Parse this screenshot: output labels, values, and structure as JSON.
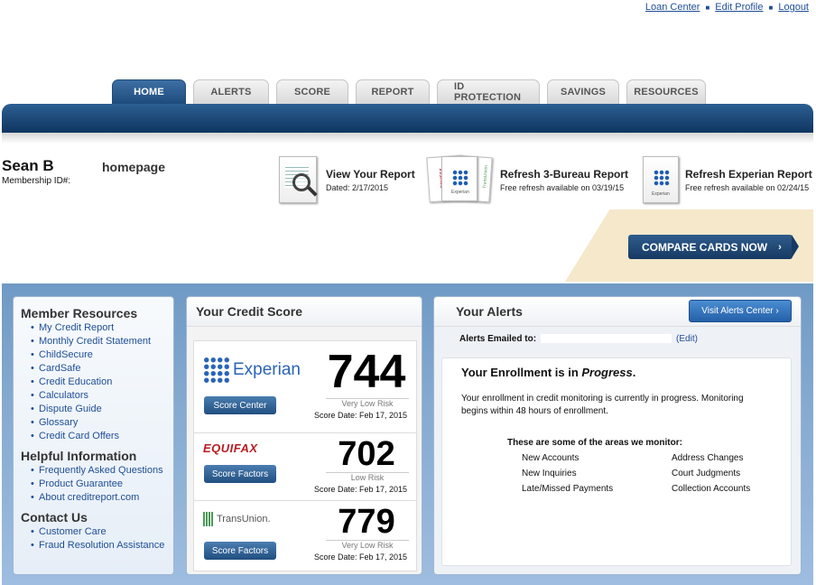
{
  "top_links": [
    "Loan Center",
    "Edit Profile",
    "Logout"
  ],
  "tabs": [
    "HOME",
    "ALERTS",
    "SCORE",
    "REPORT",
    "ID PROTECTION",
    "SAVINGS",
    "RESOURCES"
  ],
  "active_tab": "HOME",
  "user": {
    "name": "Sean B",
    "membership_label": "Membership ID#:",
    "page_label": "homepage"
  },
  "actions": [
    {
      "title": "View Your Report",
      "sub": "Dated: 2/17/2015"
    },
    {
      "title": "Refresh 3-Bureau Report",
      "sub": "Free refresh available on 03/19/15"
    },
    {
      "title": "Refresh Experian Report",
      "sub": "Free refresh available on 02/24/15"
    }
  ],
  "doc_logo_labels": [
    "EQUIFAX",
    "Experian",
    "TransUnion",
    "Experian"
  ],
  "compare_button": "COMPARE CARDS NOW",
  "resources": {
    "member_title": "Member Resources",
    "member_items": [
      "My Credit Report",
      "Monthly Credit Statement",
      "ChildSecure",
      "CardSafe",
      "Credit Education",
      "Calculators",
      "Dispute Guide",
      "Glossary",
      "Credit Card Offers"
    ],
    "helpful_title": "Helpful Information",
    "helpful_items": [
      "Frequently Asked Questions",
      "Product Guarantee",
      "About creditreport.com"
    ],
    "contact_title": "Contact Us",
    "contact_items": [
      "Customer Care",
      "Fraud Resolution Assistance"
    ]
  },
  "credit_score": {
    "title": "Your Credit Score",
    "bureaus": [
      {
        "logo": "Experian",
        "button": "Score Center",
        "score": "744",
        "risk": "Very Low Risk",
        "date": "Score Date: Feb 17, 2015"
      },
      {
        "logo": "EQUIFAX",
        "button": "Score Factors",
        "score": "702",
        "risk": "Low Risk",
        "date": "Score Date: Feb 17, 2015"
      },
      {
        "logo": "TransUnion.",
        "button": "Score Factors",
        "score": "779",
        "risk": "Very Low Risk",
        "date": "Score Date: Feb 17, 2015"
      }
    ]
  },
  "alerts": {
    "title": "Your Alerts",
    "visit_button": "Visit Alerts Center ›",
    "emailed_label": "Alerts Emailed to:",
    "edit_link": "(Edit)",
    "enroll_title_a": "Your Enrollment is in ",
    "enroll_title_b": "Progress",
    "enroll_title_c": ".",
    "enroll_text": "Your enrollment in credit monitoring is currently in progress. Monitoring begins within 48 hours of enrollment.",
    "areas_title": "These are some of the areas we monitor:",
    "areas": [
      "New Accounts",
      "Address Changes",
      "New Inquiries",
      "Court Judgments",
      "Late/Missed Payments",
      "Collection Accounts"
    ]
  }
}
